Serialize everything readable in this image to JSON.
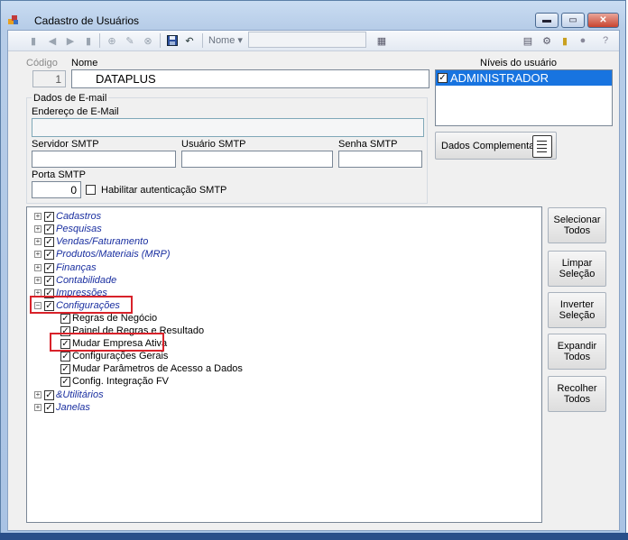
{
  "window": {
    "title": "Cadastro de Usuários",
    "minimize": "▬",
    "maximize": "▭",
    "close": "✕"
  },
  "toolbar": {
    "nome_label": "Nome ▾",
    "nome_value": ""
  },
  "form": {
    "codigo_label": "Código",
    "codigo_value": "1",
    "nome_label": "Nome",
    "nome_value": "DATAPLUS",
    "niveis_label": "Níveis do usuário",
    "niveis_items": [
      "ADMINISTRADOR"
    ],
    "email_group_title": "Dados de E-mail",
    "email_label": "Endereço de E-Mail",
    "email_value": "",
    "smtp_server_label": "Servidor SMTP",
    "smtp_user_label": "Usuário SMTP",
    "smtp_password_label": "Senha SMTP",
    "smtp_port_label": "Porta SMTP",
    "smtp_port_value": "0",
    "smtp_auth_label": "Habilitar autenticação SMTP",
    "dados_complementares": "Dados Complementares"
  },
  "tree": {
    "nodes": [
      {
        "label": "Cadastros"
      },
      {
        "label": "Pesquisas"
      },
      {
        "label": "Vendas/Faturamento"
      },
      {
        "label": "Produtos/Materiais (MRP)"
      },
      {
        "label": "Finanças"
      },
      {
        "label": "Contabilidade"
      },
      {
        "label": "Impressões"
      },
      {
        "label": "Configurações"
      },
      {
        "label": "Regras de Negócio"
      },
      {
        "label": "Painel de Regras e Resultado"
      },
      {
        "label": "Mudar Empresa Ativa"
      },
      {
        "label": "Configurações Gerais"
      },
      {
        "label": "Mudar Parâmetros de Acesso a Dados"
      },
      {
        "label": "Config. Integração FV"
      },
      {
        "label": "&Utilitários"
      },
      {
        "label": "Janelas"
      }
    ]
  },
  "buttons": {
    "selecionar": "Selecionar Todos",
    "limpar": "Limpar Seleção",
    "inverter": "Inverter Seleção",
    "expandir": "Expandir Todos",
    "recolher": "Recolher Todos"
  },
  "colors": {
    "selection": "#1874e0",
    "highlight": "#d8222a",
    "tree_text": "#1a2fa0"
  }
}
